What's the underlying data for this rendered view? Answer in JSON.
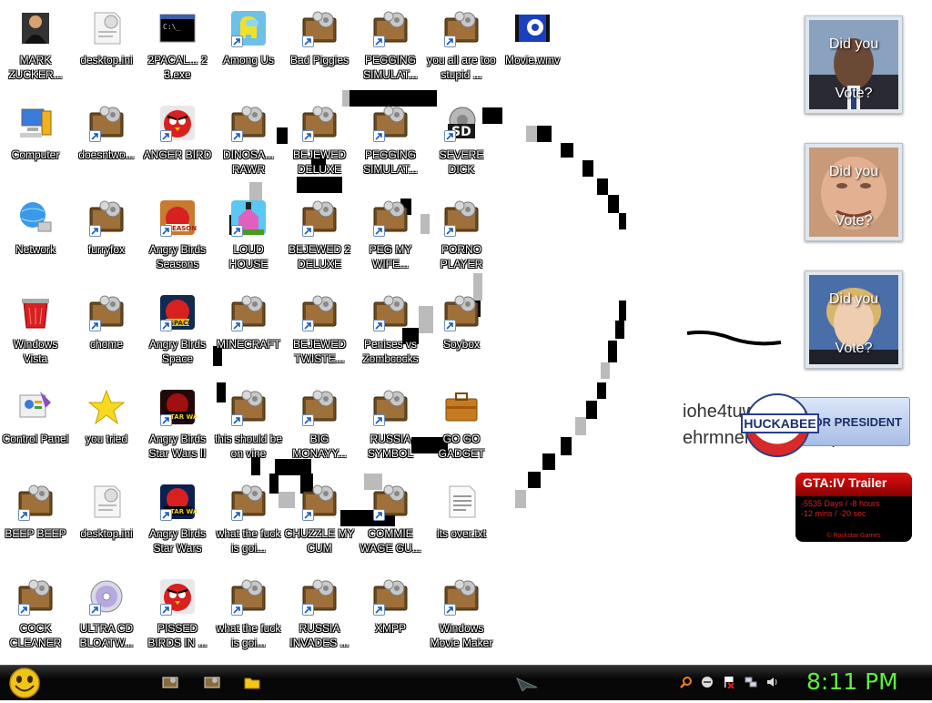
{
  "desktop": {
    "icons": [
      {
        "label": "MARK ZUCKER...",
        "icon": "person-icon"
      },
      {
        "label": "desktop.ini",
        "icon": "settings-file-icon"
      },
      {
        "label": "2PACAL... 2 3.exe",
        "icon": "console-icon"
      },
      {
        "label": "Among Us",
        "icon": "among-us-icon"
      },
      {
        "label": "Bad Piggies",
        "icon": "program-shortcut-icon"
      },
      {
        "label": "PEGGING SIMULAT...",
        "icon": "program-shortcut-icon"
      },
      {
        "label": "you all are too stupid ...",
        "icon": "program-shortcut-icon"
      },
      {
        "label": "Movie.wmv",
        "icon": "movie-file-icon"
      },
      {
        "label": "Computer",
        "icon": "computer-icon"
      },
      {
        "label": "doesntwo...",
        "icon": "program-shortcut-icon"
      },
      {
        "label": "ANGER BIRD",
        "icon": "angry-bird-icon"
      },
      {
        "label": "DINOSA... RAWR",
        "icon": "program-shortcut-icon"
      },
      {
        "label": "BEJEWED DELUXE",
        "icon": "program-shortcut-icon"
      },
      {
        "label": "PEGGING SIMULAT...",
        "icon": "program-shortcut-icon"
      },
      {
        "label": "SEVERE DICK",
        "icon": "sd-gear-icon"
      },
      {
        "label": "Network",
        "icon": "network-globe-icon"
      },
      {
        "label": "furryfox",
        "icon": "program-shortcut-icon"
      },
      {
        "label": "Angry Birds Seasons",
        "icon": "angry-birds-seasons-icon"
      },
      {
        "label": "LOUD HOUSE",
        "icon": "loud-house-icon"
      },
      {
        "label": "BEJEWED 2 DELUXE",
        "icon": "program-shortcut-icon"
      },
      {
        "label": "PEG MY WIFE...",
        "icon": "program-shortcut-icon"
      },
      {
        "label": "PORNO PLAYER",
        "icon": "program-shortcut-icon"
      },
      {
        "label": "Windows Vista",
        "icon": "recycle-bin-icon"
      },
      {
        "label": "chome",
        "icon": "program-shortcut-icon"
      },
      {
        "label": "Angry Birds Space",
        "icon": "angry-birds-space-icon"
      },
      {
        "label": "MINECRAFT",
        "icon": "program-shortcut-icon"
      },
      {
        "label": "BEJEWED TWISTE...",
        "icon": "program-shortcut-icon"
      },
      {
        "label": "Penises vs Zombcocks",
        "icon": "program-shortcut-icon"
      },
      {
        "label": "Soybox",
        "icon": "program-shortcut-icon"
      },
      {
        "label": "Control Panel",
        "icon": "control-panel-icon"
      },
      {
        "label": "you tried",
        "icon": "gold-star-icon"
      },
      {
        "label": "Angry Birds Star Wars II",
        "icon": "angry-birds-star-wars-ii-icon"
      },
      {
        "label": "this should be on vine",
        "icon": "program-shortcut-icon"
      },
      {
        "label": "BIG MONAYY...",
        "icon": "program-shortcut-icon"
      },
      {
        "label": "RUSSIA SYMBOL",
        "icon": "program-shortcut-icon"
      },
      {
        "label": "GO GO GADGET",
        "icon": "briefcase-icon"
      },
      {
        "label": "BEEP BEEP",
        "icon": "program-shortcut-icon"
      },
      {
        "label": "desktop.ini",
        "icon": "settings-file-icon"
      },
      {
        "label": "Angry Birds Star Wars",
        "icon": "angry-birds-star-wars-icon"
      },
      {
        "label": "what the fuck is goi...",
        "icon": "program-shortcut-icon"
      },
      {
        "label": "CHUZZLE MY CUM",
        "icon": "program-shortcut-icon"
      },
      {
        "label": "COMMIE WAGE GU...",
        "icon": "program-shortcut-icon"
      },
      {
        "label": "its over.txt",
        "icon": "text-file-icon"
      },
      {
        "label": "COCK CLEANER",
        "icon": "program-shortcut-icon"
      },
      {
        "label": "ULTRA CD BLOATW...",
        "icon": "cd-disc-icon"
      },
      {
        "label": "PISSED BIRDS IN ...",
        "icon": "angry-bird-icon"
      },
      {
        "label": "what the fuck is goi...",
        "icon": "program-shortcut-icon"
      },
      {
        "label": "RUSSIA INVADES ...",
        "icon": "program-shortcut-icon"
      },
      {
        "label": "XMPP",
        "icon": "program-shortcut-icon"
      },
      {
        "label": "Windows Movie Maker",
        "icon": "program-shortcut-icon"
      }
    ]
  },
  "gadgets": {
    "vote": [
      {
        "top_text": "Did you",
        "bottom_text": "Vote?",
        "photo": "candidate-photo-icon"
      },
      {
        "top_text": "Did you",
        "bottom_text": "Vote?",
        "photo": "candidate-photo-icon"
      },
      {
        "top_text": "Did you",
        "bottom_text": "Vote?",
        "photo": "candidate-photo-icon"
      }
    ],
    "note_text": "iohe4tuwe ewiotkwe ehrmnerwohkmwepbt kom",
    "huckabee": {
      "name": "HUCKABEE",
      "slogan": "FOR PRESIDENT"
    },
    "gta": {
      "title": "GTA:IV Trailer",
      "line1": "-5535 Days / -8 hours",
      "line2": "-12 mins / -20 sec",
      "footer": "© Rockstar Games"
    }
  },
  "taskbar": {
    "clock": "8:11 PM",
    "start_icon": "smiley-orb-icon",
    "pinned": [
      "program-icon",
      "program-icon",
      "folder-icon"
    ],
    "center_icon": "cursor-icon",
    "tray": [
      "search-icon",
      "minus-icon",
      "flag-icon",
      "network-icon",
      "volume-icon"
    ]
  },
  "colors": {
    "clock": "#5ef03a",
    "taskbar": "#0a0a0a",
    "desktop_bg": "#ffffff"
  }
}
